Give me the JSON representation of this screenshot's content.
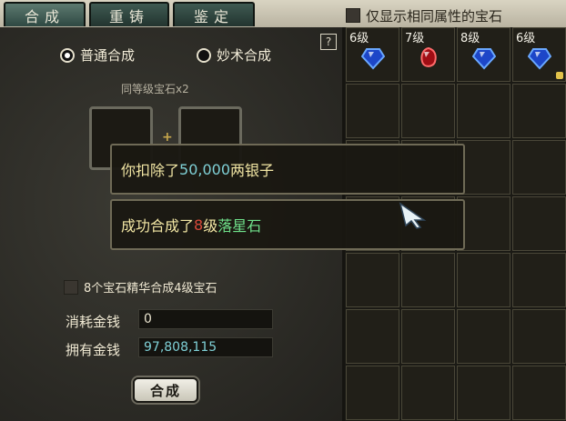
{
  "tabs": [
    {
      "label": "合成",
      "active": true
    },
    {
      "label": "重铸",
      "active": false
    },
    {
      "label": "鉴定",
      "active": false
    }
  ],
  "filter": {
    "label": "仅显示相同属性的宝石",
    "checked": false
  },
  "help": {
    "label": "?"
  },
  "modes": [
    {
      "label": "普通合成",
      "selected": true
    },
    {
      "label": "妙术合成",
      "selected": false
    }
  ],
  "subtitle": "同等级宝石x2",
  "essence": {
    "label": "8个宝石精华合成4级宝石",
    "checked": false
  },
  "cost": {
    "label": "消耗金钱",
    "value": "0"
  },
  "owned": {
    "label": "拥有金钱",
    "value": "97,808,115"
  },
  "compose_button": "合成",
  "inventory": {
    "items": [
      {
        "level": "6级",
        "gem": "blue",
        "locked": false
      },
      {
        "level": "7级",
        "gem": "red",
        "locked": false
      },
      {
        "level": "8级",
        "gem": "blue",
        "locked": false
      },
      {
        "level": "6级",
        "gem": "blue",
        "locked": true
      }
    ]
  },
  "popups": {
    "deduct": {
      "prefix": "你扣除了",
      "amount": "50,000",
      "suffix": "两银子"
    },
    "success": {
      "prefix": "成功合成了",
      "level": "8",
      "mid": "级",
      "gem": "落星石"
    }
  },
  "colors": {
    "money": "#7fd0d6",
    "gem_name": "#6fe08a",
    "level": "#d84a3a",
    "popup_text": "#f2e6a4"
  }
}
